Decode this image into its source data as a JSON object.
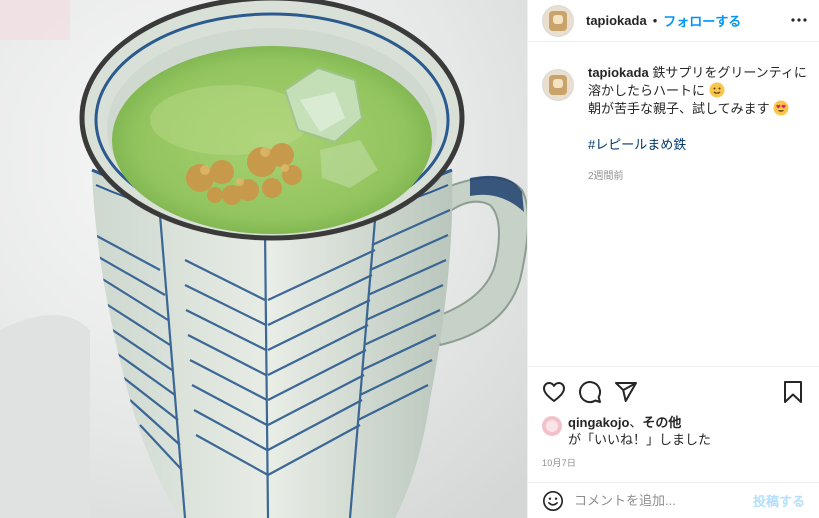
{
  "post": {
    "photo_alt": "green tea",
    "header": {
      "username": "tapiokada",
      "separator": "•",
      "follow_label": "フォローする",
      "more_icon": "more-horizontal-icon"
    },
    "caption": {
      "username": "tapiokada",
      "line1": "鉄サプリをグリーンティに溶かしたらハートに",
      "emoji1": "slightly-smiling-face",
      "line2": "朝が苦手な親子、試してみます",
      "emoji2": "heart-eyes-face",
      "hashtag": "#レピールまめ鉄",
      "time_ago": "2週間前"
    },
    "actions": {
      "like_icon": "heart-icon",
      "comment_icon": "comment-icon",
      "share_icon": "share-icon",
      "save_icon": "bookmark-icon"
    },
    "likes": {
      "liker": "qingakojo",
      "joiner": "、",
      "others": "その他",
      "suffix": "が「いいね！」しました"
    },
    "date": "10月7日",
    "comment": {
      "placeholder": "コメントを追加...",
      "post_label": "投稿する"
    }
  },
  "colors": {
    "link_blue": "#0095f6",
    "post_disabled": "#b2dffc",
    "secondary_text": "#8e8e8e",
    "border": "#efefef"
  }
}
